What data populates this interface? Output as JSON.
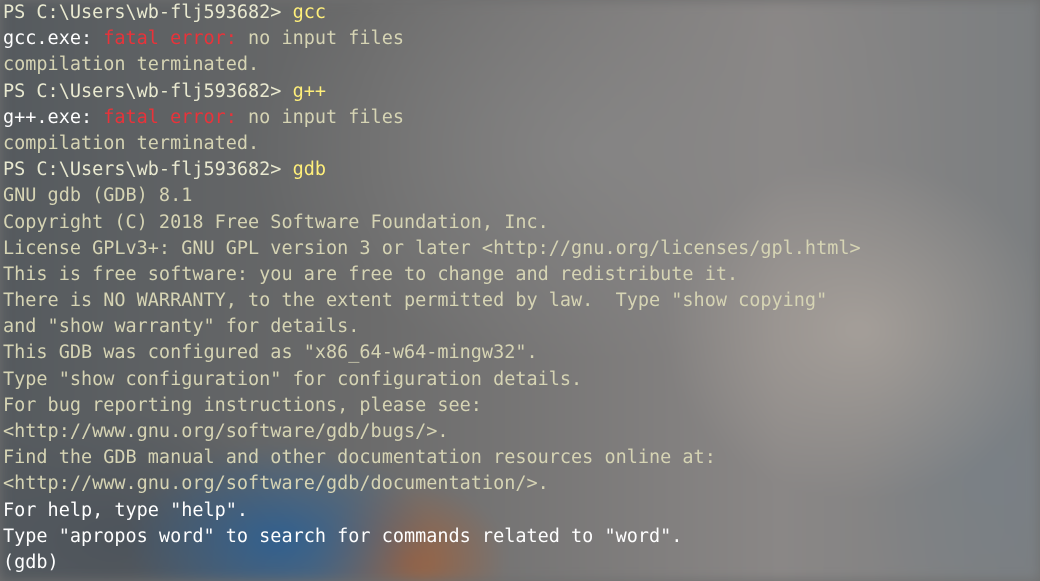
{
  "terminal": {
    "lines": [
      {
        "prompt": "PS C:\\Users\\wb-flj593682> ",
        "cmd": "gcc"
      },
      {
        "prog": "gcc.exe: ",
        "err": "fatal error:",
        "text": " no input files"
      },
      {
        "text": "compilation terminated."
      },
      {
        "prompt": "PS C:\\Users\\wb-flj593682> ",
        "cmd": "g++"
      },
      {
        "prog": "g++.exe: ",
        "err": "fatal error:",
        "text": " no input files"
      },
      {
        "text": "compilation terminated."
      },
      {
        "prompt": "PS C:\\Users\\wb-flj593682> ",
        "cmd": "gdb"
      },
      {
        "text": "GNU gdb (GDB) 8.1"
      },
      {
        "text": "Copyright (C) 2018 Free Software Foundation, Inc."
      },
      {
        "text": "License GPLv3+: GNU GPL version 3 or later <http://gnu.org/licenses/gpl.html>"
      },
      {
        "text": "This is free software: you are free to change and redistribute it."
      },
      {
        "text": "There is NO WARRANTY, to the extent permitted by law.  Type \"show copying\""
      },
      {
        "text": "and \"show warranty\" for details."
      },
      {
        "text": "This GDB was configured as \"x86_64-w64-mingw32\"."
      },
      {
        "text": "Type \"show configuration\" for configuration details."
      },
      {
        "text": "For bug reporting instructions, please see:"
      },
      {
        "text": "<http://www.gnu.org/software/gdb/bugs/>."
      },
      {
        "text": "Find the GDB manual and other documentation resources online at:"
      },
      {
        "text": "<http://www.gnu.org/software/gdb/documentation/>."
      },
      {
        "text": "For help, type \"help\"."
      },
      {
        "text": "Type \"apropos word\" to search for commands related to \"word\"."
      },
      {
        "text": "(gdb) "
      }
    ]
  },
  "colors": {
    "output_text": "#d6d4b4",
    "command": "#ffef7a",
    "error": "#e8333a",
    "program": "#ffffff"
  }
}
